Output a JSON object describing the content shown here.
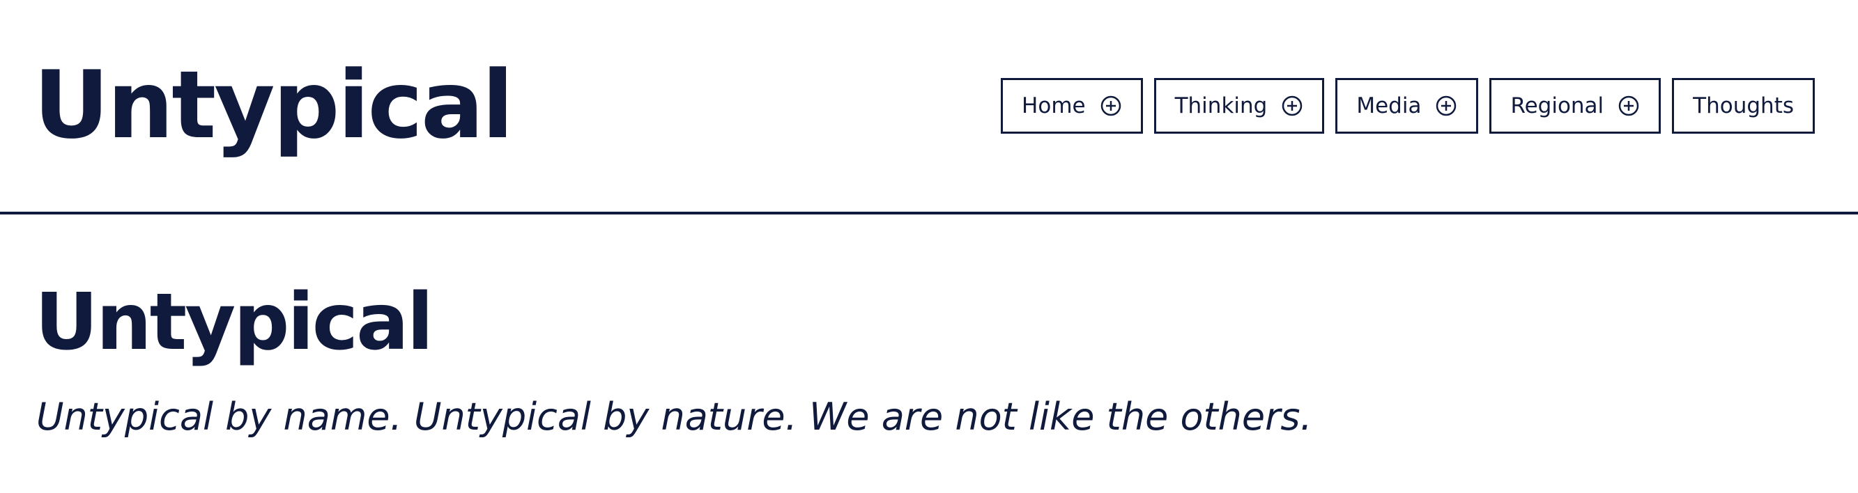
{
  "header": {
    "logo": "Untypical"
  },
  "nav": {
    "items": [
      {
        "label": "Home",
        "icon": "plus-circle-icon"
      },
      {
        "label": "Thinking",
        "icon": "plus-circle-icon"
      },
      {
        "label": "Media",
        "icon": "plus-circle-icon"
      },
      {
        "label": "Regional",
        "icon": "plus-circle-icon"
      },
      {
        "label": "Thoughts"
      }
    ]
  },
  "main": {
    "title": "Untypical",
    "tagline": "Untypical by name. Untypical by nature. We are not like the others."
  },
  "colors": {
    "primary": "#101a3c",
    "background": "#ffffff"
  }
}
